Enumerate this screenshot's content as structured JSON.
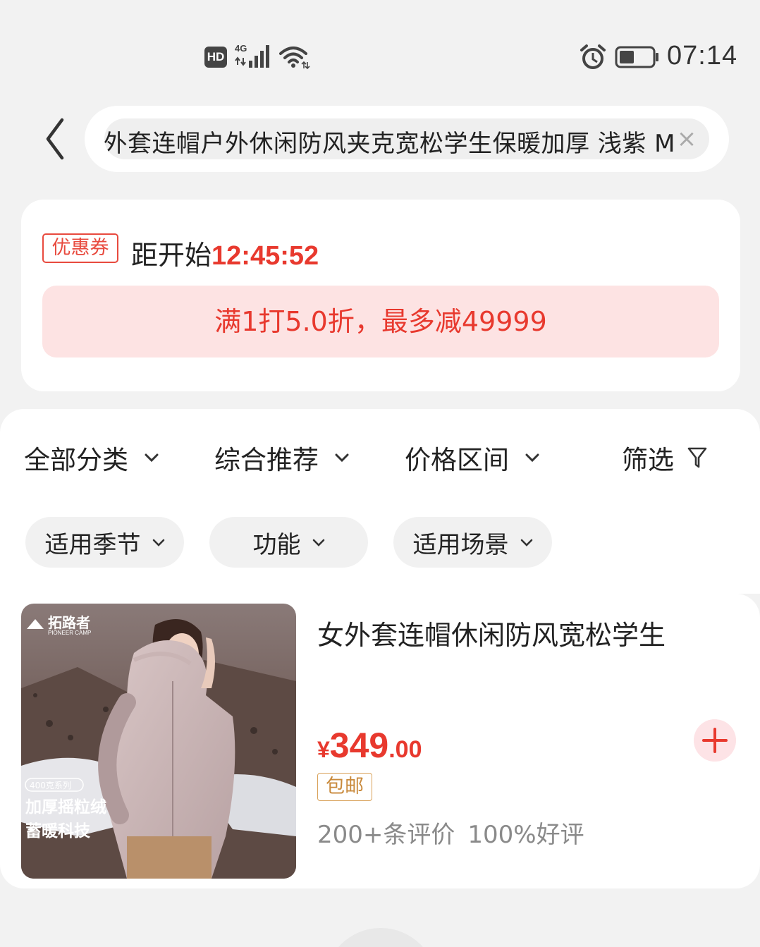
{
  "status_bar": {
    "hd_label": "HD",
    "network": "4G",
    "time": "07:14",
    "icons": [
      "hd-icon",
      "signal-4g-icon",
      "wifi-icon",
      "alarm-icon",
      "battery-icon"
    ]
  },
  "search": {
    "query": "女外套连帽户外休闲防风夹克宽松学生保暖加厚 浅紫 M",
    "clear_label": "×",
    "back_icon": "back-arrow-icon"
  },
  "coupon": {
    "tag": "优惠券",
    "countdown_prefix": "距开始",
    "countdown_time": "12:45:52",
    "offer": "满1打5.0折，最多减49999",
    "accent_color": "#e8392e"
  },
  "sort_bar": {
    "items": [
      {
        "label": "全部分类",
        "icon": "chevron-down-icon"
      },
      {
        "label": "综合推荐",
        "icon": "chevron-down-icon"
      },
      {
        "label": "价格区间",
        "icon": "chevron-down-icon"
      },
      {
        "label": "筛选",
        "icon": "filter-icon"
      }
    ]
  },
  "chips": [
    {
      "label": "适用季节"
    },
    {
      "label": "功能"
    },
    {
      "label": "适用场景"
    }
  ],
  "product": {
    "title": "女外套连帽休闲防风宽松学生",
    "price_currency": "¥",
    "price_int": "349",
    "price_dec": ".00",
    "shipping_badge": "包邮",
    "reviews_count": "200+条评价",
    "positive_rate": "100%好评",
    "image": {
      "brand_name": "拓路者",
      "brand_sub": "PIONEER CAMP",
      "series_badge": "400克系列",
      "caption_line1": "加厚摇粒绒",
      "caption_line2": "蓄暖科技"
    }
  }
}
